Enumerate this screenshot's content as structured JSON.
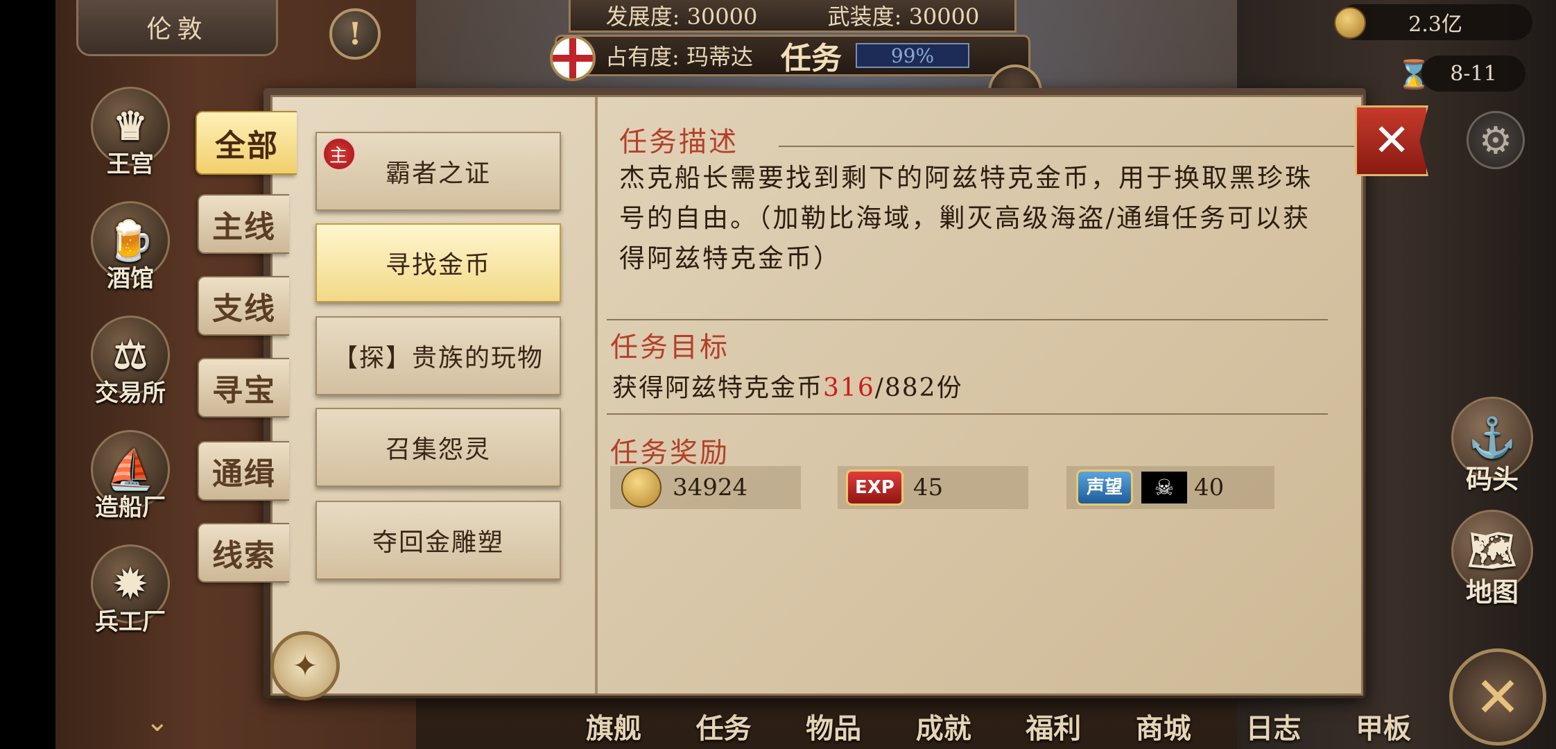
{
  "top": {
    "city": "伦敦",
    "development": "发展度: 30000",
    "armament": "武装度: 30000",
    "occupancy": "占有度: 玛蒂达",
    "task_label": "任务",
    "progress_text": "99%",
    "gold": "2.3亿",
    "date": "8-11"
  },
  "left_nav": [
    {
      "label": "王宫",
      "icon": "crown-icon"
    },
    {
      "label": "酒馆",
      "icon": "beer-mug-icon"
    },
    {
      "label": "交易所",
      "icon": "scales-icon"
    },
    {
      "label": "造船厂",
      "icon": "ship-icon"
    },
    {
      "label": "兵工厂",
      "icon": "cannon-icon"
    }
  ],
  "right_nav": [
    {
      "label": "码头",
      "icon": "dock-icon"
    },
    {
      "label": "地图",
      "icon": "map-scroll-icon"
    }
  ],
  "bottom_nav": [
    "旗舰",
    "任务",
    "物品",
    "成就",
    "福利",
    "商城",
    "日志",
    "甲板"
  ],
  "tabs": [
    "全部",
    "主线",
    "支线",
    "寻宝",
    "通缉",
    "线索"
  ],
  "quests": [
    {
      "title": "霸者之证",
      "badge": "主"
    },
    {
      "title": "寻找金币"
    },
    {
      "title": "【探】贵族的玩物"
    },
    {
      "title": "召集怨灵"
    },
    {
      "title": "夺回金雕塑"
    }
  ],
  "detail": {
    "desc_title": "任务描述",
    "desc_text": "杰克船长需要找到剩下的阿兹特克金币，用于换取黑珍珠号的自由。（加勒比海域，剿灭高级海盗/通缉任务可以获得阿兹特克金币）",
    "goal_title": "任务目标",
    "goal_prefix": "获得阿兹特克金币",
    "goal_current": "316",
    "goal_suffix": "/882份",
    "reward_title": "任务奖励",
    "reward_gold": "34924",
    "exp_label": "EXP",
    "reward_exp": "45",
    "rep_label": "声望",
    "reward_rep": "40"
  },
  "colors": {
    "accent_red": "#b3402a",
    "highlight_red": "#cc1c1c",
    "active_tab": "#f1cf6c"
  }
}
